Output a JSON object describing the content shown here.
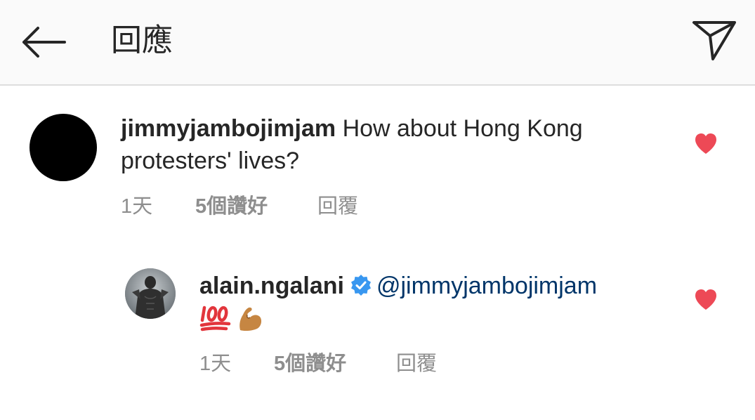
{
  "header": {
    "title": "回應"
  },
  "comment": {
    "username": "jimmyjambojimjam",
    "text": "How about Hong Kong protesters' lives?",
    "time": "1天",
    "likes": "5個讚好",
    "reply_label": "回覆"
  },
  "reply": {
    "username": "alain.ngalani",
    "mention": "@jimmyjambojimjam",
    "time": "1天",
    "likes": "5個讚好",
    "reply_label": "回覆"
  },
  "colors": {
    "heart": "#ed4956",
    "verified": "#3897f0",
    "mention": "#003569",
    "meta": "#8e8e8e"
  },
  "icons": [
    "back-arrow-icon",
    "send-icon",
    "heart-icon",
    "verified-badge-icon",
    "hundred-points-emoji",
    "flexed-biceps-emoji"
  ]
}
